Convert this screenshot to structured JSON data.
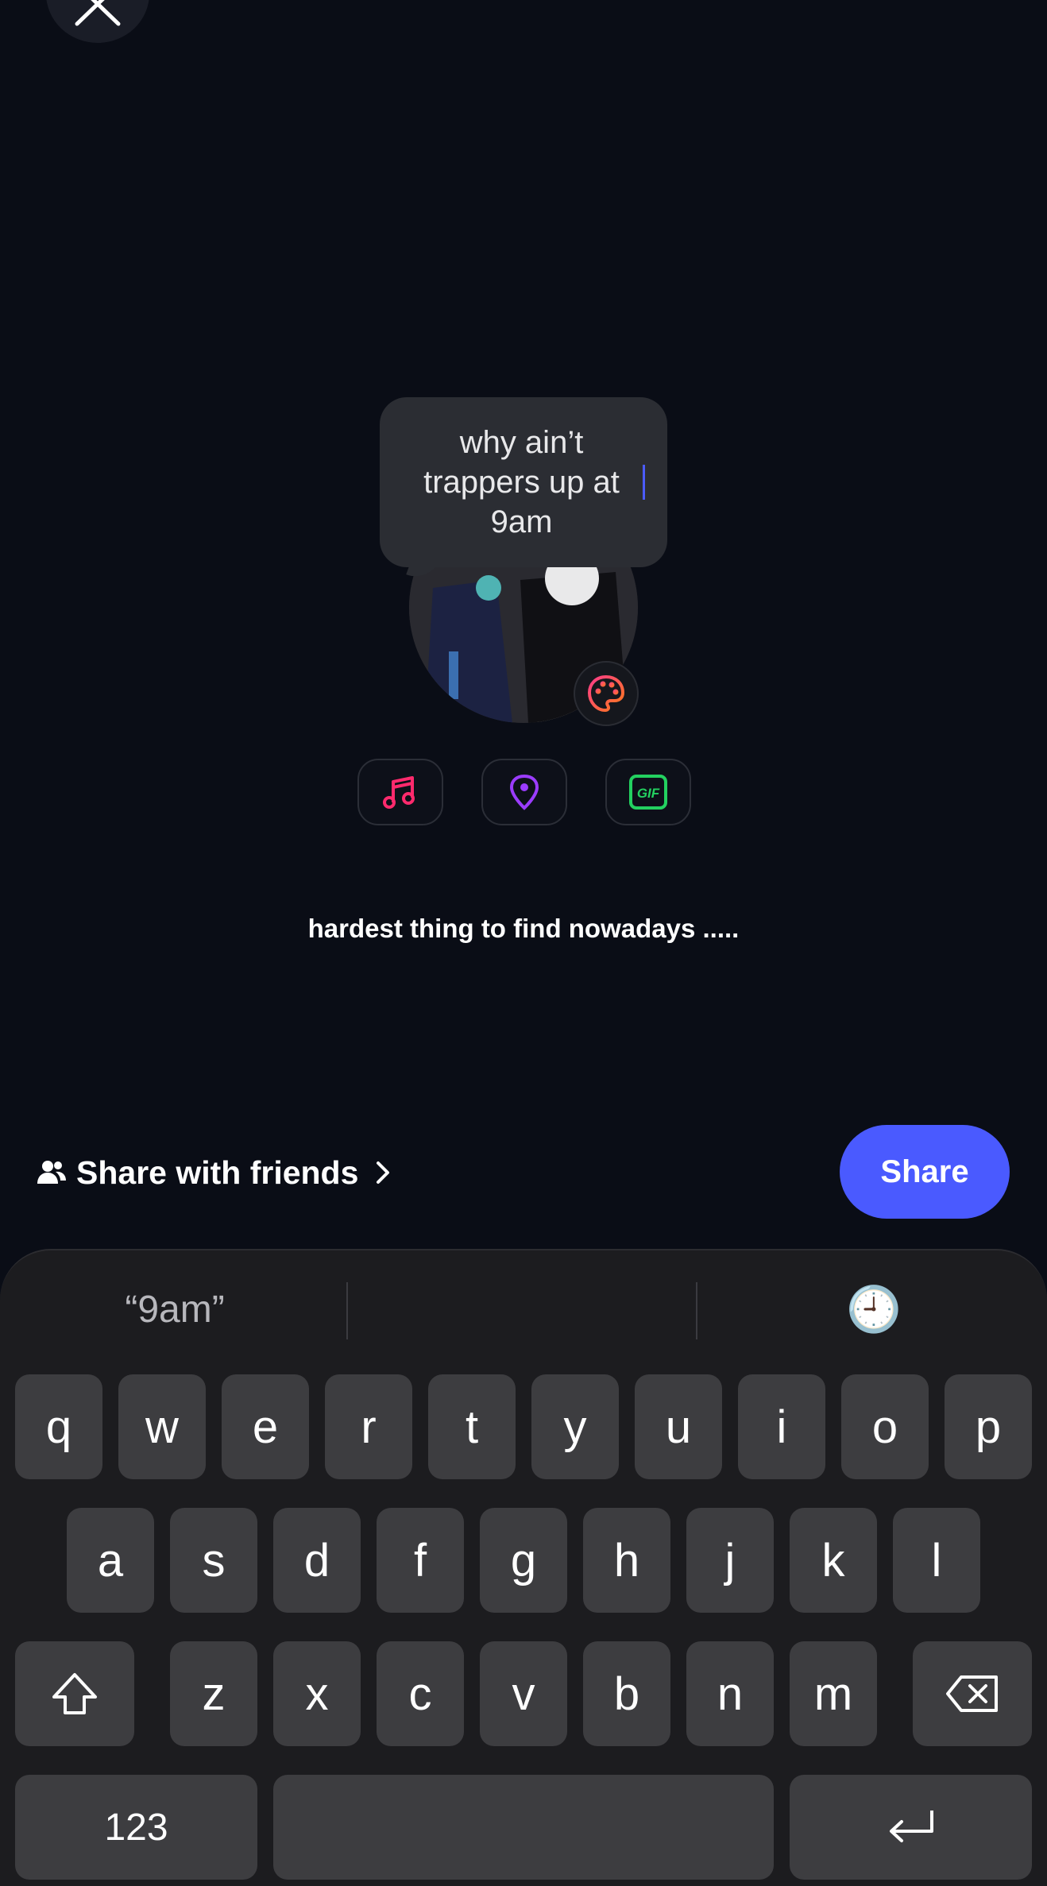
{
  "post": {
    "bubble_text": "why ain’t trappers up at 9am",
    "caption": "hardest thing to find nowadays .....",
    "tools": [
      "music-icon",
      "location-pin-icon",
      "gif-icon"
    ]
  },
  "share_bar": {
    "audience_label": "Share with friends",
    "share_label": "Share"
  },
  "keyboard": {
    "suggestion": "“9am”",
    "emoji_suggestion": "🕘",
    "row1": [
      "q",
      "w",
      "e",
      "r",
      "t",
      "y",
      "u",
      "i",
      "o",
      "p"
    ],
    "row2": [
      "a",
      "s",
      "d",
      "f",
      "g",
      "h",
      "j",
      "k",
      "l"
    ],
    "row3": [
      "z",
      "x",
      "c",
      "v",
      "b",
      "n",
      "m"
    ],
    "numbers_label": "123"
  },
  "colors": {
    "background": "#0a0d16",
    "accent": "#4a5aff",
    "music": "#ff2a6d",
    "location": "#9b3cff",
    "gif": "#23d160"
  }
}
